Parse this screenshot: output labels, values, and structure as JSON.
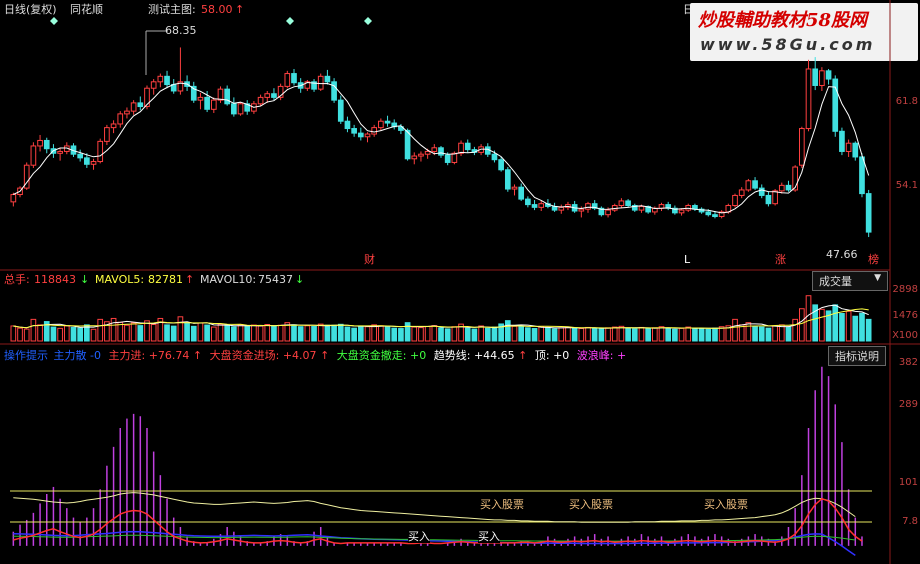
{
  "header": {
    "chart_name": "日线(复权)",
    "app": "同花顺",
    "test_label": "测试主图:",
    "test_value": "58.00",
    "test_arrow": "↑",
    "right_stub": "日"
  },
  "watermark": {
    "line1": "炒股輔助教材58股网",
    "line2": "www.58Gu.com"
  },
  "price_panel": {
    "high_label": "68.35",
    "last_label": "47.66",
    "axis": [
      "61.8",
      "54.1"
    ],
    "markers": [
      "财",
      "L",
      "涨",
      "榜"
    ]
  },
  "volume_panel": {
    "label_main": "总手:",
    "value_main": "118843",
    "arrow_main": "↓",
    "ma5_label": "MAVOL5:",
    "ma5_value": "82781",
    "ma5_arrow": "↑",
    "ma10_label": "MAVOL10:",
    "ma10_value": "75437",
    "ma10_arrow": "↓",
    "dropdown": "成交量",
    "axis": [
      "2898",
      "1476",
      "X100"
    ]
  },
  "indicator_panel": {
    "items": [
      {
        "label": "操作提示",
        "value": "",
        "color": "#2060ff"
      },
      {
        "label": "主力散",
        "value": "-0",
        "color": "#2060ff"
      },
      {
        "label": "主力进:",
        "value": "+76.74",
        "arrow": "↑",
        "color": "#ff4040"
      },
      {
        "label": "大盘资金进场:",
        "value": "+4.07",
        "arrow": "↑",
        "color": "#ff4040"
      },
      {
        "label": "大盘资金撤走:",
        "value": "+0",
        "color": "#40ff40"
      },
      {
        "label": "趋势线:",
        "value": "+44.65",
        "arrow": "↑",
        "color": "#ffffff"
      },
      {
        "label": "顶:",
        "value": "+0",
        "color": "#ffffff"
      },
      {
        "label": "波浪峰:",
        "value": "+",
        "color": "#ff40ff"
      }
    ],
    "explain_button": "指标说明",
    "axis": [
      "382",
      "289",
      "101",
      "7.8"
    ],
    "signals": [
      "买入",
      "买入",
      "买入股票",
      "买入股票",
      "买入股票"
    ]
  },
  "chart_data": {
    "type": "candlestick",
    "price": {
      "ylim": [
        44.5,
        72
      ],
      "candles": [
        [
          51.5,
          52.5,
          51.0,
          52.3
        ],
        [
          52.3,
          53.2,
          52.0,
          53.0
        ],
        [
          53.0,
          55.8,
          52.8,
          55.5
        ],
        [
          55.5,
          58.0,
          55.2,
          57.6
        ],
        [
          57.6,
          58.8,
          57.0,
          58.2
        ],
        [
          58.2,
          58.5,
          56.8,
          57.3
        ],
        [
          57.3,
          57.8,
          56.3,
          56.8
        ],
        [
          56.8,
          57.4,
          56.0,
          57.0
        ],
        [
          57.0,
          58.0,
          56.7,
          57.6
        ],
        [
          57.6,
          57.9,
          56.4,
          56.7
        ],
        [
          56.7,
          57.2,
          55.9,
          56.3
        ],
        [
          56.3,
          56.8,
          55.2,
          55.6
        ],
        [
          55.6,
          56.2,
          55.0,
          55.9
        ],
        [
          55.9,
          58.4,
          55.7,
          58.1
        ],
        [
          58.1,
          59.9,
          57.7,
          59.6
        ],
        [
          59.6,
          60.4,
          59.0,
          60.0
        ],
        [
          60.0,
          61.4,
          59.6,
          61.1
        ],
        [
          61.1,
          61.8,
          60.6,
          61.4
        ],
        [
          61.4,
          62.6,
          61.0,
          62.3
        ],
        [
          62.3,
          63.0,
          61.5,
          61.9
        ],
        [
          61.9,
          64.2,
          61.6,
          63.9
        ],
        [
          63.9,
          64.9,
          63.2,
          64.6
        ],
        [
          64.6,
          65.5,
          64.0,
          65.2
        ],
        [
          65.2,
          65.8,
          63.9,
          64.3
        ],
        [
          64.3,
          64.9,
          63.3,
          63.6
        ],
        [
          63.6,
          68.35,
          63.2,
          64.6
        ],
        [
          64.6,
          65.3,
          63.6,
          64.1
        ],
        [
          64.1,
          64.6,
          62.3,
          62.6
        ],
        [
          62.6,
          63.4,
          61.6,
          62.9
        ],
        [
          62.9,
          63.6,
          61.3,
          61.6
        ],
        [
          61.6,
          62.9,
          61.2,
          62.6
        ],
        [
          62.6,
          64.1,
          62.3,
          63.8
        ],
        [
          63.8,
          64.2,
          62.0,
          62.2
        ],
        [
          62.2,
          62.9,
          60.8,
          61.1
        ],
        [
          61.1,
          62.4,
          60.9,
          62.2
        ],
        [
          62.2,
          62.6,
          61.0,
          61.4
        ],
        [
          61.4,
          62.5,
          61.1,
          62.2
        ],
        [
          62.2,
          63.2,
          61.9,
          62.9
        ],
        [
          62.9,
          63.6,
          62.3,
          63.3
        ],
        [
          63.3,
          63.9,
          62.6,
          62.9
        ],
        [
          62.9,
          64.4,
          62.6,
          64.1
        ],
        [
          64.1,
          65.8,
          63.9,
          65.5
        ],
        [
          65.5,
          66.0,
          64.2,
          64.5
        ],
        [
          64.5,
          65.0,
          63.4,
          63.9
        ],
        [
          63.9,
          64.8,
          63.6,
          64.6
        ],
        [
          64.6,
          64.9,
          63.5,
          63.8
        ],
        [
          63.8,
          65.5,
          63.6,
          65.2
        ],
        [
          65.2,
          65.9,
          64.3,
          64.6
        ],
        [
          64.6,
          65.0,
          62.3,
          62.6
        ],
        [
          62.6,
          63.1,
          60.0,
          60.3
        ],
        [
          60.3,
          60.8,
          59.1,
          59.5
        ],
        [
          59.5,
          59.9,
          58.6,
          59.0
        ],
        [
          59.0,
          59.6,
          58.2,
          58.6
        ],
        [
          58.6,
          59.1,
          58.0,
          58.9
        ],
        [
          58.9,
          59.9,
          58.6,
          59.6
        ],
        [
          59.6,
          60.6,
          59.3,
          60.3
        ],
        [
          60.3,
          60.9,
          59.7,
          60.1
        ],
        [
          60.1,
          60.5,
          59.4,
          59.7
        ],
        [
          59.7,
          60.0,
          58.9,
          59.3
        ],
        [
          59.3,
          59.5,
          56.0,
          56.2
        ],
        [
          56.2,
          56.9,
          55.6,
          56.5
        ],
        [
          56.5,
          57.0,
          55.9,
          56.7
        ],
        [
          56.7,
          57.3,
          56.2,
          57.0
        ],
        [
          57.0,
          57.8,
          56.6,
          57.4
        ],
        [
          57.4,
          57.6,
          56.3,
          56.6
        ],
        [
          56.6,
          56.9,
          55.5,
          55.8
        ],
        [
          55.8,
          57.0,
          55.6,
          56.8
        ],
        [
          56.8,
          58.2,
          56.5,
          57.9
        ],
        [
          57.9,
          58.3,
          56.9,
          57.2
        ],
        [
          57.2,
          57.5,
          56.6,
          56.9
        ],
        [
          56.9,
          57.8,
          56.6,
          57.5
        ],
        [
          57.5,
          57.9,
          56.4,
          56.7
        ],
        [
          56.7,
          57.1,
          55.8,
          56.1
        ],
        [
          56.1,
          56.4,
          54.8,
          55.0
        ],
        [
          55.0,
          55.3,
          52.6,
          52.9
        ],
        [
          52.9,
          53.4,
          52.2,
          53.1
        ],
        [
          53.1,
          53.5,
          51.6,
          51.8
        ],
        [
          51.8,
          52.1,
          50.9,
          51.2
        ],
        [
          51.2,
          51.7,
          50.6,
          50.9
        ],
        [
          50.9,
          51.6,
          50.5,
          51.3
        ],
        [
          51.3,
          51.8,
          50.8,
          51.0
        ],
        [
          51.0,
          51.4,
          50.4,
          50.6
        ],
        [
          50.6,
          51.2,
          50.2,
          50.9
        ],
        [
          50.9,
          51.5,
          50.6,
          51.2
        ],
        [
          51.2,
          51.6,
          50.3,
          50.5
        ],
        [
          50.5,
          51.0,
          49.8,
          50.7
        ],
        [
          50.7,
          51.5,
          50.3,
          51.3
        ],
        [
          51.3,
          51.7,
          50.6,
          50.8
        ],
        [
          50.8,
          51.0,
          49.9,
          50.1
        ],
        [
          50.1,
          50.9,
          49.8,
          50.6
        ],
        [
          50.6,
          51.3,
          50.4,
          51.1
        ],
        [
          51.1,
          51.9,
          50.8,
          51.6
        ],
        [
          51.6,
          51.8,
          50.9,
          51.1
        ],
        [
          51.1,
          51.3,
          50.4,
          50.6
        ],
        [
          50.6,
          51.2,
          50.3,
          51.0
        ],
        [
          51.0,
          51.1,
          50.2,
          50.4
        ],
        [
          50.4,
          51.0,
          50.1,
          50.8
        ],
        [
          50.8,
          51.4,
          50.5,
          51.2
        ],
        [
          51.2,
          51.5,
          50.6,
          50.8
        ],
        [
          50.8,
          51.1,
          50.1,
          50.3
        ],
        [
          50.3,
          50.8,
          50.0,
          50.6
        ],
        [
          50.6,
          51.3,
          50.4,
          51.1
        ],
        [
          51.1,
          51.3,
          50.5,
          50.7
        ],
        [
          50.7,
          50.9,
          50.2,
          50.4
        ],
        [
          50.4,
          50.7,
          49.9,
          50.1
        ],
        [
          50.1,
          50.5,
          49.7,
          49.9
        ],
        [
          49.9,
          50.6,
          49.7,
          50.4
        ],
        [
          50.4,
          51.3,
          50.2,
          51.1
        ],
        [
          51.1,
          52.4,
          50.9,
          52.2
        ],
        [
          52.2,
          53.1,
          51.9,
          52.8
        ],
        [
          52.8,
          54.0,
          52.6,
          53.8
        ],
        [
          53.8,
          54.2,
          52.8,
          53.0
        ],
        [
          53.0,
          53.4,
          51.9,
          52.2
        ],
        [
          52.2,
          52.6,
          51.0,
          51.3
        ],
        [
          51.3,
          52.9,
          51.1,
          52.7
        ],
        [
          52.7,
          53.6,
          52.4,
          53.3
        ],
        [
          53.3,
          53.8,
          52.6,
          52.8
        ],
        [
          52.8,
          55.5,
          52.6,
          55.3
        ],
        [
          55.5,
          59.7,
          55.2,
          59.5
        ],
        [
          59.5,
          67.0,
          59.2,
          66.0
        ],
        [
          66.0,
          67.3,
          63.7,
          64.2
        ],
        [
          64.2,
          66.2,
          63.6,
          65.8
        ],
        [
          65.8,
          66.0,
          64.3,
          64.9
        ],
        [
          64.9,
          65.3,
          58.6,
          59.2
        ],
        [
          59.2,
          59.6,
          56.6,
          57.0
        ],
        [
          57.0,
          58.3,
          56.4,
          57.9
        ],
        [
          57.9,
          58.1,
          56.0,
          56.4
        ],
        [
          56.4,
          56.8,
          52.0,
          52.4
        ],
        [
          52.4,
          52.8,
          47.66,
          48.2
        ]
      ]
    },
    "volume": {
      "ylim": [
        0,
        3000
      ],
      "values": [
        820,
        700,
        650,
        1180,
        880,
        1060,
        760,
        690,
        820,
        740,
        700,
        880,
        640,
        1180,
        1050,
        1230,
        1020,
        860,
        990,
        840,
        1100,
        900,
        1230,
        880,
        810,
        1320,
        990,
        800,
        980,
        870,
        760,
        920,
        830,
        770,
        880,
        790,
        870,
        820,
        900,
        810,
        860,
        1000,
        880,
        780,
        830,
        790,
        920,
        860,
        860,
        910,
        760,
        700,
        820,
        780,
        880,
        830,
        790,
        700,
        680,
        1000,
        760,
        730,
        790,
        840,
        710,
        660,
        780,
        920,
        700,
        650,
        820,
        700,
        760,
        930,
        1110,
        800,
        780,
        720,
        680,
        790,
        730,
        660,
        720,
        760,
        720,
        680,
        740,
        700,
        660,
        720,
        760,
        800,
        700,
        660,
        740,
        680,
        720,
        780,
        700,
        640,
        690,
        760,
        710,
        660,
        640,
        700,
        780,
        830,
        1180,
        880,
        1000,
        780,
        760,
        700,
        820,
        880,
        760,
        1180,
        1760,
        2470,
        1970,
        1730,
        1640,
        1970,
        1500,
        1620,
        1350,
        1510,
        1180
      ]
    },
    "indicator": {
      "ylim": [
        -30,
        390
      ],
      "bars": [
        30,
        45,
        55,
        70,
        90,
        110,
        125,
        100,
        80,
        60,
        50,
        60,
        80,
        120,
        170,
        210,
        250,
        270,
        280,
        275,
        250,
        200,
        150,
        100,
        60,
        40,
        20,
        10,
        5,
        8,
        15,
        25,
        40,
        30,
        20,
        10,
        5,
        5,
        10,
        20,
        25,
        20,
        10,
        5,
        10,
        30,
        40,
        20,
        5,
        0,
        5,
        5,
        5,
        5,
        5,
        5,
        5,
        5,
        5,
        0,
        0,
        5,
        5,
        0,
        0,
        5,
        10,
        15,
        10,
        5,
        5,
        5,
        5,
        5,
        5,
        5,
        10,
        10,
        5,
        10,
        20,
        15,
        10,
        15,
        20,
        15,
        20,
        25,
        15,
        20,
        10,
        15,
        20,
        15,
        25,
        20,
        15,
        20,
        10,
        15,
        20,
        25,
        20,
        15,
        20,
        25,
        20,
        15,
        10,
        15,
        20,
        25,
        20,
        15,
        10,
        20,
        40,
        80,
        150,
        250,
        330,
        380,
        360,
        300,
        220,
        120,
        60,
        20
      ],
      "trend": [
        102,
        101,
        100,
        99,
        97,
        95,
        93,
        92,
        91,
        92,
        94,
        97,
        99,
        101,
        103,
        106,
        110,
        112,
        113,
        112,
        110,
        108,
        105,
        102,
        99,
        96,
        93,
        91,
        90,
        89,
        88,
        88,
        89,
        90,
        91,
        92,
        93,
        92,
        91,
        90,
        91,
        92,
        94,
        95,
        96,
        94,
        90,
        87,
        84,
        81,
        79,
        77,
        75,
        74,
        73,
        72,
        71,
        70,
        69,
        68,
        67,
        66,
        65,
        64,
        63,
        62,
        61,
        60,
        59,
        58,
        57,
        56,
        55,
        55,
        54,
        54,
        53,
        53,
        52,
        52,
        52,
        51,
        51,
        51,
        51,
        50,
        50,
        50,
        50,
        50,
        50,
        50,
        50,
        51,
        51,
        51,
        51,
        52,
        52,
        52,
        53,
        53,
        53,
        54,
        54,
        55,
        55,
        56,
        57,
        58,
        59,
        60,
        62,
        64,
        66,
        70,
        76,
        84,
        92,
        98,
        101,
        100,
        96,
        90,
        82,
        72,
        62
      ]
    }
  }
}
